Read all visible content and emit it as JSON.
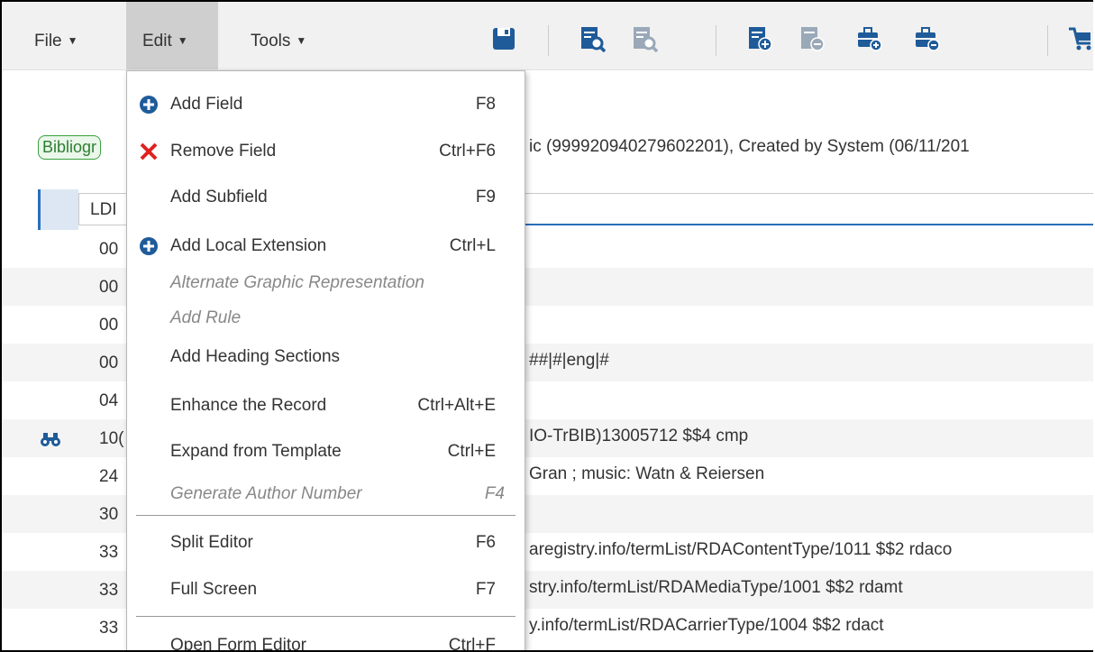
{
  "menubar": {
    "file": "File",
    "edit": "Edit",
    "tools": "Tools"
  },
  "toolbar_icons": [
    "save-icon",
    "search-record-icon",
    "search-record-disabled-icon",
    "add-record-icon",
    "add-record-disabled-icon",
    "add-to-set-icon",
    "remove-from-set-icon",
    "cart-icon"
  ],
  "colors": {
    "accent": "#2a6ebb",
    "toolbar_icon": "#1f5b99",
    "toolbar_icon_disabled": "#9aa9b8",
    "remove": "#e02020",
    "badge_border": "#3aa040"
  },
  "record": {
    "badge": "Bibliogr",
    "info": "ic (999920940279602201), Created by System (06/11/201"
  },
  "ldr": {
    "tag": "LDI"
  },
  "fields": [
    {
      "tag": "00",
      "value": ""
    },
    {
      "tag": "00",
      "value": ""
    },
    {
      "tag": "00",
      "value": ""
    },
    {
      "tag": "00",
      "value": "##|#|eng|#"
    },
    {
      "tag": "04",
      "value": ""
    },
    {
      "tag": "10(",
      "value": "IO-TrBIB)13005712 $$4 cmp",
      "has_search": true
    },
    {
      "tag": "24",
      "value": "Gran ; music: Watn & Reiersen"
    },
    {
      "tag": "30",
      "value": ""
    },
    {
      "tag": "33",
      "value": "aregistry.info/termList/RDAContentType/1011 $$2 rdaco"
    },
    {
      "tag": "33",
      "value": "stry.info/termList/RDAMediaType/1001 $$2 rdamt"
    },
    {
      "tag": "33",
      "value": "y.info/termList/RDACarrierType/1004 $$2 rdact"
    }
  ],
  "edit_menu": {
    "items": [
      {
        "label": "Add Field",
        "shortcut": "F8",
        "icon": "plus-circle-icon",
        "disabled": false
      },
      {
        "label": "Remove Field",
        "shortcut": "Ctrl+F6",
        "icon": "red-x-icon",
        "disabled": false
      },
      {
        "label": "Add Subfield",
        "shortcut": "F9",
        "disabled": false
      },
      {
        "label": "Add Local Extension",
        "shortcut": "Ctrl+L",
        "icon": "plus-circle-icon",
        "disabled": false
      },
      {
        "label": "Alternate Graphic Representation",
        "shortcut": "",
        "disabled": true
      },
      {
        "label": "Add Rule",
        "shortcut": "",
        "disabled": true
      },
      {
        "label": "Add Heading Sections",
        "shortcut": "",
        "disabled": false
      },
      {
        "label": "Enhance the Record",
        "shortcut": "Ctrl+Alt+E",
        "disabled": false
      },
      {
        "label": "Expand from Template",
        "shortcut": "Ctrl+E",
        "disabled": false
      },
      {
        "label": "Generate Author Number",
        "shortcut": "F4",
        "disabled": true
      },
      {
        "label": "Split Editor",
        "shortcut": "F6",
        "disabled": false
      },
      {
        "label": "Full Screen",
        "shortcut": "F7",
        "disabled": false
      },
      {
        "label": "Open Form Editor",
        "shortcut": "Ctrl+F",
        "disabled": false
      }
    ]
  }
}
